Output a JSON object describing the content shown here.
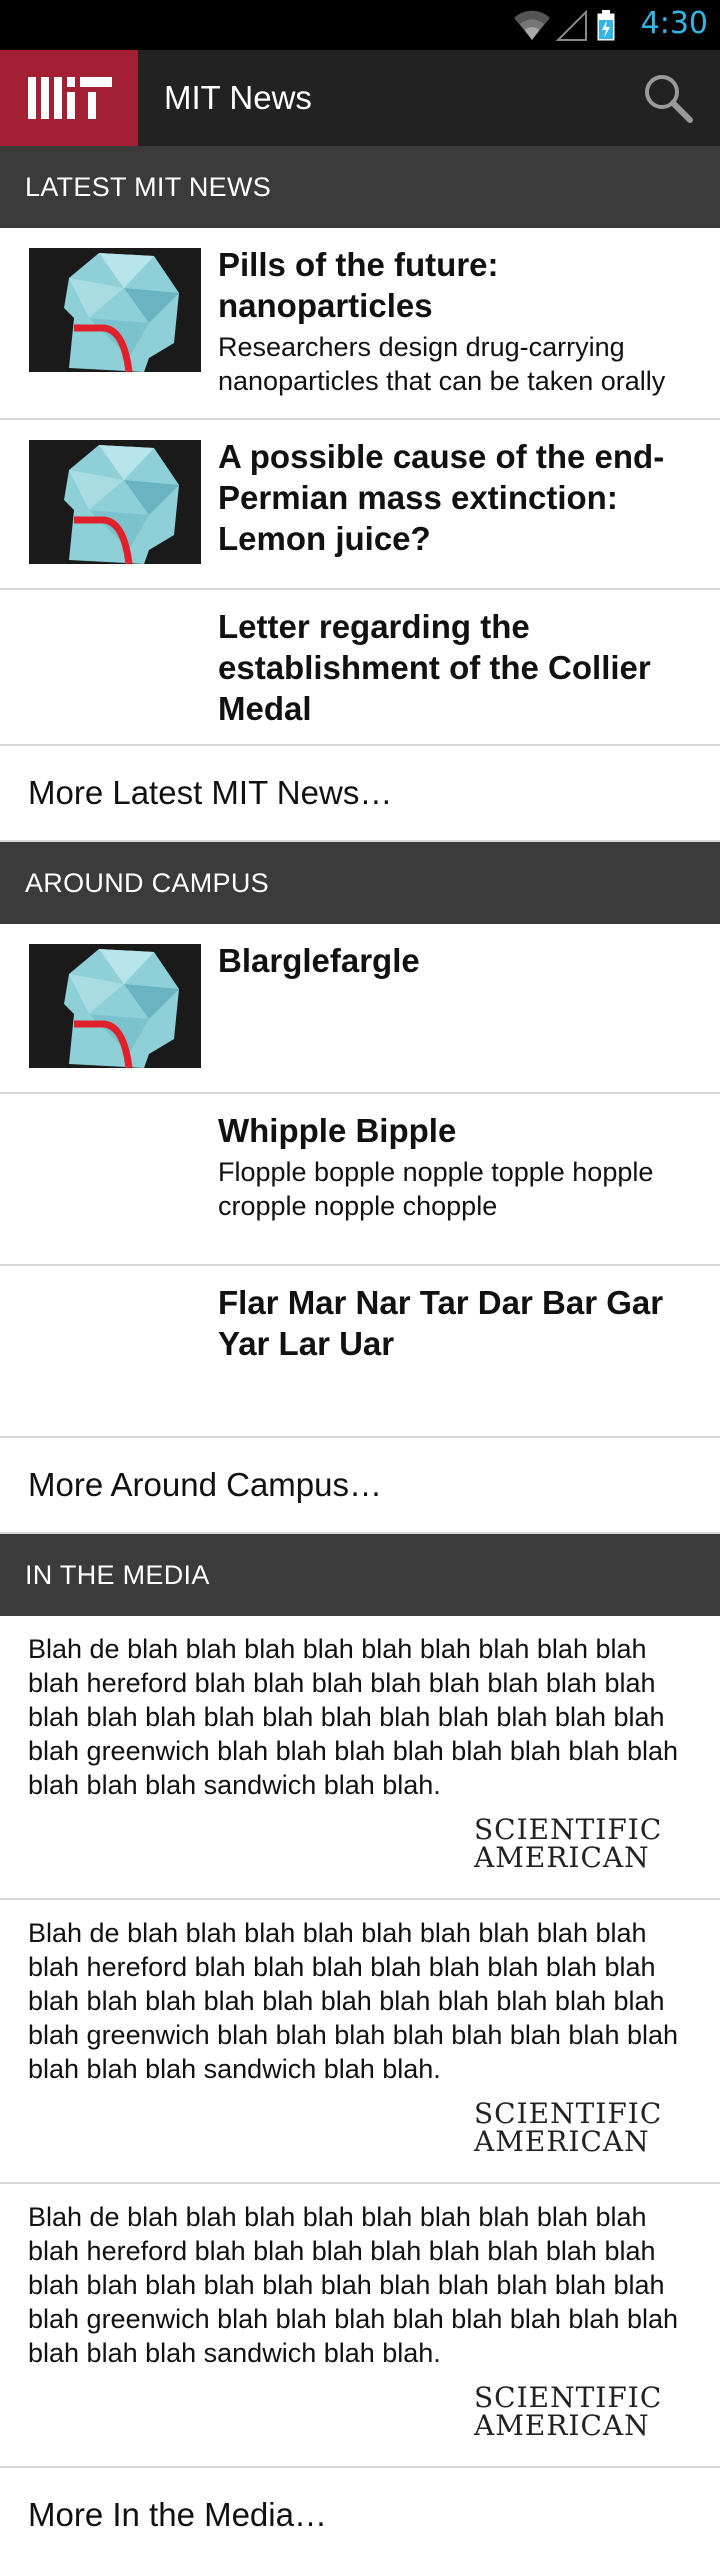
{
  "status_bar": {
    "time": "4:30"
  },
  "app_bar": {
    "title": "MIT News"
  },
  "sections": {
    "latest": {
      "header": "LATEST MIT NEWS",
      "stories": [
        {
          "title": "Pills of the future: nanoparticles",
          "summary": "Researchers design drug-carrying nanoparticles that can be taken orally"
        },
        {
          "title": "A possible cause of the end-Permian mass extinction: Lemon juice?"
        },
        {
          "title": "Letter regarding the establishment of the Collier Medal"
        }
      ],
      "more": "More Latest MIT News…"
    },
    "campus": {
      "header": "AROUND CAMPUS",
      "stories": [
        {
          "title": "Blarglefargle"
        },
        {
          "title": "Whipple Bipple",
          "summary": "Flopple bopple nopple topple hopple cropple nopple chopple"
        },
        {
          "title": "Flar Mar Nar Tar Dar Bar Gar Yar Lar Uar"
        }
      ],
      "more": "More Around Campus…"
    },
    "media": {
      "header": "IN THE MEDIA",
      "items": [
        {
          "text": "Blah de blah blah blah blah blah blah blah blah blah blah hereford blah blah blah blah blah blah blah blah blah blah blah blah blah blah blah blah blah blah blah blah greenwich blah blah blah blah blah blah blah blah blah blah blah sandwich blah blah.",
          "source": "SCIENTIFIC AMERICAN"
        },
        {
          "text": "Blah de blah blah blah blah blah blah blah blah blah blah hereford blah blah blah blah blah blah blah blah blah blah blah blah blah blah blah blah blah blah blah blah greenwich blah blah blah blah blah blah blah blah blah blah blah sandwich blah blah.",
          "source": "SCIENTIFIC AMERICAN"
        },
        {
          "text": "Blah de blah blah blah blah blah blah blah blah blah blah hereford blah blah blah blah blah blah blah blah blah blah blah blah blah blah blah blah blah blah blah blah greenwich blah blah blah blah blah blah blah blah blah blah blah sandwich blah blah.",
          "source": "SCIENTIFIC AMERICAN"
        }
      ],
      "more": "More In the Media…"
    }
  },
  "colors": {
    "brand_red": "#a31f34",
    "app_bar": "#222222",
    "section_header": "#3b3b3b",
    "status_accent": "#33b5e5"
  },
  "icons": [
    "wifi-icon",
    "signal-icon",
    "battery-icon",
    "mit-logo",
    "search-icon",
    "news-thumbnail"
  ]
}
